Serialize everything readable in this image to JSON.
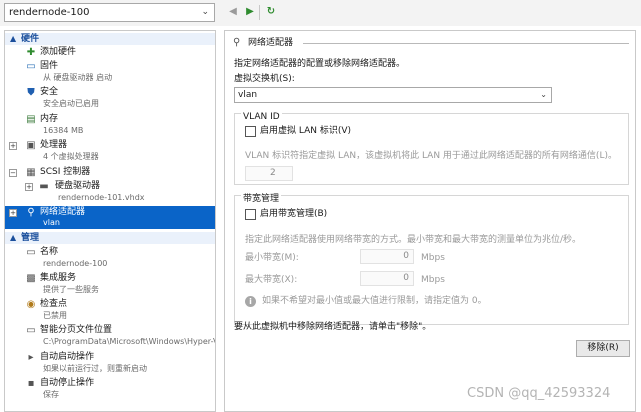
{
  "toolbar": {
    "vm_name": "rendernode-100",
    "back_icon": "arrow-left-icon",
    "forward_icon": "arrow-right-icon",
    "refresh_icon": "refresh-icon"
  },
  "tree": {
    "hardware_header": "硬件",
    "add_hardware": "添加硬件",
    "firmware": "固件",
    "firmware_sub": "从 硬盘驱动器 启动",
    "security": "安全",
    "security_sub": "安全启动已启用",
    "memory": "内存",
    "memory_sub": "16384 MB",
    "processor": "处理器",
    "processor_sub": "4 个虚拟处理器",
    "scsi": "SCSI 控制器",
    "hdd": "硬盘驱动器",
    "hdd_sub": "rendernode-101.vhdx",
    "nic": "网络适配器",
    "nic_sub": "vlan",
    "management_header": "管理",
    "name": "名称",
    "name_sub": "rendernode-100",
    "integration": "集成服务",
    "integration_sub": "提供了一些服务",
    "checkpoints": "检查点",
    "checkpoints_sub": "已禁用",
    "paging": "智能分页文件位置",
    "paging_sub": "C:\\ProgramData\\Microsoft\\Windows\\Hyper-V",
    "autostart": "自动启动操作",
    "autostart_sub": "如果以前运行过，则重新启动",
    "autostop": "自动停止操作",
    "autostop_sub": "保存"
  },
  "panel": {
    "group_title": "网络适配器",
    "description": "指定网络适配器的配置或移除网络适配器。",
    "switch_label": "虚拟交换机(S):",
    "switch_value": "vlan",
    "vlan_title": "VLAN ID",
    "vlan_checkbox": "启用虚拟 LAN 标识(V)",
    "vlan_hint": "VLAN 标识符指定虚拟 LAN，该虚拟机将此 LAN 用于通过此网络适配器的所有网络通信(L)。",
    "vlan_value": "2",
    "bandwidth_title": "带宽管理",
    "bandwidth_checkbox": "启用带宽管理(B)",
    "bandwidth_hint": "指定此网络适配器使用网络带宽的方式。最小带宽和最大带宽的测量单位为兆位/秒。",
    "min_label": "最小带宽(M):",
    "min_value": "0",
    "min_unit": "Mbps",
    "max_label": "最大带宽(X):",
    "max_value": "0",
    "max_unit": "Mbps",
    "info_text": "如果不希望对最小值或最大值进行限制，请指定值为 0。",
    "remove_hint": "要从此虚拟机中移除网络适配器，请单击\"移除\"。",
    "remove_button": "移除(R)"
  },
  "watermark": "CSDN @qq_42593324"
}
